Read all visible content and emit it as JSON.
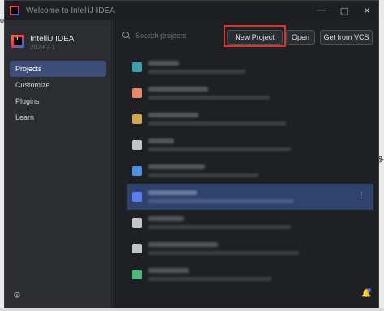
{
  "window": {
    "title": "Welcome to IntelliJ IDEA",
    "controls": {
      "minimize": "—",
      "maximize": "▢",
      "close": "✕"
    }
  },
  "brand": {
    "name": "IntelliJ IDEA",
    "version": "2023.2.1",
    "logo_text": "IJ"
  },
  "sidebar": {
    "items": [
      {
        "label": "Projects",
        "active": true
      },
      {
        "label": "Customize",
        "active": false
      },
      {
        "label": "Plugins",
        "active": false
      },
      {
        "label": "Learn",
        "active": false
      }
    ],
    "settings_icon": "gear-icon"
  },
  "toolbar": {
    "search_placeholder": "Search projects",
    "new_project_label": "New Project",
    "open_label": "Open",
    "vcs_label": "Get from VCS"
  },
  "projects": [
    {
      "icon_color": "#3aa0b1"
    },
    {
      "icon_color": "#e8896a"
    },
    {
      "icon_color": "#d4a84a"
    },
    {
      "icon_color": "#c2c4c9"
    },
    {
      "icon_color": "#4e8fe0"
    },
    {
      "icon_color": "#5c7df0",
      "selected": true
    },
    {
      "icon_color": "#c2c4c9"
    },
    {
      "icon_color": "#c2c4c9"
    },
    {
      "icon_color": "#4cb87a"
    }
  ],
  "colors": {
    "accent": "#3d4f78",
    "highlight_box": "#e0312b",
    "selected_row": "#2e436e"
  },
  "desktop": {
    "left_glyph": "ot",
    "right_glyph": "多"
  }
}
